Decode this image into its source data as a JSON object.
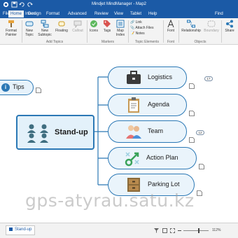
{
  "window": {
    "title": "Mindjet MindManager - Map2"
  },
  "menu": {
    "tabs": [
      "File",
      "Home",
      "Insert",
      "Design",
      "Format",
      "Advanced",
      "Review",
      "View",
      "Tablet",
      "Help"
    ],
    "active_tab": "Home",
    "search_label": "Find"
  },
  "ribbon": {
    "format_painter": "Format Painter",
    "new_topic": "New Topic",
    "new_subtopic": "New Subtopic",
    "floating": "Floating",
    "callout": "Callout",
    "icons": "Icons",
    "tags": "Tags",
    "map_index": "Map Index",
    "link": "Link",
    "attach_files": "Attach Files",
    "notes": "Notes",
    "font": "Font",
    "relationship": "Relationship",
    "boundary": "Boundary",
    "share": "Share",
    "groups": {
      "add_topics": "Add Topics",
      "markers": "Markers",
      "topic_elements": "Topic Elements",
      "font": "Font",
      "objects": "Objects"
    }
  },
  "map": {
    "central_topic": "Stand-up",
    "floating_topic": "Tips",
    "floating_badge": "i",
    "subtopics": [
      {
        "label": "Logistics",
        "icon": "briefcase-icon",
        "badge": "17"
      },
      {
        "label": "Agenda",
        "icon": "clipboard-icon",
        "badge": ""
      },
      {
        "label": "Team",
        "icon": "people-icon",
        "badge": "12"
      },
      {
        "label": "Action Plan",
        "icon": "arrow-icon",
        "badge": ""
      },
      {
        "label": "Parking Lot",
        "icon": "drawers-icon",
        "badge": ""
      }
    ]
  },
  "status": {
    "document_tab": "Stand-up",
    "zoom": "112%",
    "zoom_level": 0.6
  },
  "watermark": "gps-atyrau.satu.kz",
  "colors": {
    "brand": "#1b5aa6",
    "node_border": "#2b78b5",
    "node_fill": "#eaf4fb"
  }
}
